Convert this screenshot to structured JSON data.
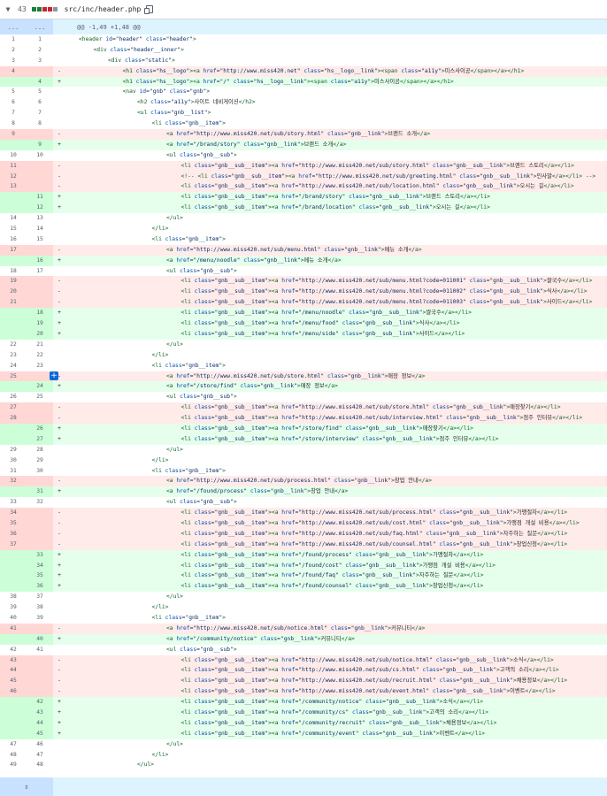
{
  "file": {
    "changes": "43",
    "path": "src/inc/header.php",
    "stat_colors": [
      "#1a7f37",
      "#1a7f37",
      "#cf222e",
      "#cf222e",
      "#8c959f"
    ]
  },
  "hunk": {
    "left": "...",
    "right": "...",
    "text": "@@ -1,49 +1,48 @@"
  },
  "rows": [
    {
      "type": "ctx",
      "l": "1",
      "r": "1",
      "code": "<header id=\"header\" class=\"header\">",
      "indent": 0
    },
    {
      "type": "ctx",
      "l": "2",
      "r": "2",
      "code": "<div class=\"header__inner\">",
      "indent": 1
    },
    {
      "type": "ctx",
      "l": "3",
      "r": "3",
      "code": "<div class=\"static\">",
      "indent": 2
    },
    {
      "type": "del",
      "l": "4",
      "r": "",
      "code": "<h1 class=\"hs__logo\"><a href=\"http://www.miss420.net\" class=\"hs__logo__link\"><span class=\"a11y\">미스사이공</span></a></h1>",
      "indent": 3
    },
    {
      "type": "add",
      "l": "",
      "r": "4",
      "code": "<h1 class=\"hs__logo\"><a href=\"/\" class=\"hs__logo__link\"><span class=\"a11y\">미스사이공</span></a></h1>",
      "indent": 3
    },
    {
      "type": "ctx",
      "l": "5",
      "r": "5",
      "code": "<nav id=\"gnb\" class=\"gnb\">",
      "indent": 3
    },
    {
      "type": "ctx",
      "l": "6",
      "r": "6",
      "code": "<h2 class=\"a11y\">사이트 네비게이션</h2>",
      "indent": 4
    },
    {
      "type": "ctx",
      "l": "7",
      "r": "7",
      "code": "<ul class=\"gnb__list\">",
      "indent": 4
    },
    {
      "type": "ctx",
      "l": "8",
      "r": "8",
      "code": "<li class=\"gnb__item\">",
      "indent": 5
    },
    {
      "type": "del",
      "l": "9",
      "r": "",
      "code": "<a href=\"http://www.miss420.net/sub/story.html\" class=\"gnb__link\">브랜드 소개</a>",
      "indent": 6
    },
    {
      "type": "add",
      "l": "",
      "r": "9",
      "code": "<a href=\"/brand/story\" class=\"gnb__link\">브랜드 소개</a>",
      "indent": 6
    },
    {
      "type": "ctx",
      "l": "10",
      "r": "10",
      "code": "<ul class=\"gnb__sub\">",
      "indent": 6
    },
    {
      "type": "del",
      "l": "11",
      "r": "",
      "code": "<li class=\"gnb__sub__item\"><a href=\"http://www.miss420.net/sub/story.html\" class=\"gnb__sub__link\">브랜드 스토리</a></li>",
      "indent": 7
    },
    {
      "type": "del",
      "l": "12",
      "r": "",
      "code": "<!-- <li class=\"gnb__sub__item\"><a href=\"http://www.miss420.net/sub/greeting.html\" class=\"gnb__sub__link\">인사말</a></li> -->",
      "indent": 7
    },
    {
      "type": "del",
      "l": "13",
      "r": "",
      "code": "<li class=\"gnb__sub__item\"><a href=\"http://www.miss420.net/sub/location.html\" class=\"gnb__sub__link\">오시는 길</a></li>",
      "indent": 7
    },
    {
      "type": "add",
      "l": "",
      "r": "11",
      "code": "<li class=\"gnb__sub__item\"><a href=\"/brand/story\" class=\"gnb__sub__link\">브랜드 스토리</a></li>",
      "indent": 7
    },
    {
      "type": "add",
      "l": "",
      "r": "12",
      "code": "<li class=\"gnb__sub__item\"><a href=\"/brand/location\" class=\"gnb__sub__link\">오시는 길</a></li>",
      "indent": 7
    },
    {
      "type": "ctx",
      "l": "14",
      "r": "13",
      "code": "</ul>",
      "indent": 6
    },
    {
      "type": "ctx",
      "l": "15",
      "r": "14",
      "code": "</li>",
      "indent": 5
    },
    {
      "type": "ctx",
      "l": "16",
      "r": "15",
      "code": "<li class=\"gnb__item\">",
      "indent": 5
    },
    {
      "type": "del",
      "l": "17",
      "r": "",
      "code": "<a href=\"http://www.miss420.net/sub/menu.html\" class=\"gnb__link\">메뉴 소개</a>",
      "indent": 6
    },
    {
      "type": "add",
      "l": "",
      "r": "16",
      "code": "<a href=\"/menu/noodle\" class=\"gnb__link\">메뉴 소개</a>",
      "indent": 6
    },
    {
      "type": "ctx",
      "l": "18",
      "r": "17",
      "code": "<ul class=\"gnb__sub\">",
      "indent": 6
    },
    {
      "type": "del",
      "l": "19",
      "r": "",
      "code": "<li class=\"gnb__sub__item\"><a href=\"http://www.miss420.net/sub/menu.html?code=011001\" class=\"gnb__sub__link\">쌀국수</a></li>",
      "indent": 7
    },
    {
      "type": "del",
      "l": "20",
      "r": "",
      "code": "<li class=\"gnb__sub__item\"><a href=\"http://www.miss420.net/sub/menu.html?code=011002\" class=\"gnb__sub__link\">식사</a></li>",
      "indent": 7
    },
    {
      "type": "del",
      "l": "21",
      "r": "",
      "code": "<li class=\"gnb__sub__item\"><a href=\"http://www.miss420.net/sub/menu.html?code=011003\" class=\"gnb__sub__link\">사이드</a></li>",
      "indent": 7
    },
    {
      "type": "add",
      "l": "",
      "r": "18",
      "code": "<li class=\"gnb__sub__item\"><a href=\"/menu/noodle\" class=\"gnb__sub__link\">쌀국수</a></li>",
      "indent": 7
    },
    {
      "type": "add",
      "l": "",
      "r": "19",
      "code": "<li class=\"gnb__sub__item\"><a href=\"/menu/food\" class=\"gnb__sub__link\">식사</a></li>",
      "indent": 7
    },
    {
      "type": "add",
      "l": "",
      "r": "20",
      "code": "<li class=\"gnb__sub__item\"><a href=\"/menu/side\" class=\"gnb__sub__link\">사이드</a></li>",
      "indent": 7
    },
    {
      "type": "ctx",
      "l": "22",
      "r": "21",
      "code": "</ul>",
      "indent": 6
    },
    {
      "type": "ctx",
      "l": "23",
      "r": "22",
      "code": "</li>",
      "indent": 5
    },
    {
      "type": "ctx",
      "l": "24",
      "r": "23",
      "code": "<li class=\"gnb__item\">",
      "indent": 5
    },
    {
      "type": "del",
      "l": "25",
      "r": "",
      "code": "<a href=\"http://www.miss420.net/sub/store.html\" class=\"gnb__link\">매장 정보</a>",
      "indent": 6,
      "plus": true
    },
    {
      "type": "add",
      "l": "",
      "r": "24",
      "code": "<a href=\"/store/find\" class=\"gnb__link\">매장 정보</a>",
      "indent": 6
    },
    {
      "type": "ctx",
      "l": "26",
      "r": "25",
      "code": "<ul class=\"gnb__sub\">",
      "indent": 6
    },
    {
      "type": "del",
      "l": "27",
      "r": "",
      "code": "<li class=\"gnb__sub__item\"><a href=\"http://www.miss420.net/sub/store.html\" class=\"gnb__sub__link\">매장찾기</a></li>",
      "indent": 7
    },
    {
      "type": "del",
      "l": "28",
      "r": "",
      "code": "<li class=\"gnb__sub__item\"><a href=\"http://www.miss420.net/sub/interview.html\" class=\"gnb__sub__link\">점주 인터뷰</a></li>",
      "indent": 7
    },
    {
      "type": "add",
      "l": "",
      "r": "26",
      "code": "<li class=\"gnb__sub__item\"><a href=\"/store/find\" class=\"gnb__sub__link\">매장찾기</a></li>",
      "indent": 7
    },
    {
      "type": "add",
      "l": "",
      "r": "27",
      "code": "<li class=\"gnb__sub__item\"><a href=\"/store/interview\" class=\"gnb__sub__link\">점주 인터뷰</a></li>",
      "indent": 7
    },
    {
      "type": "ctx",
      "l": "29",
      "r": "28",
      "code": "</ul>",
      "indent": 6
    },
    {
      "type": "ctx",
      "l": "30",
      "r": "29",
      "code": "</li>",
      "indent": 5
    },
    {
      "type": "ctx",
      "l": "31",
      "r": "30",
      "code": "<li class=\"gnb__item\">",
      "indent": 5
    },
    {
      "type": "del",
      "l": "32",
      "r": "",
      "code": "<a href=\"http://www.miss420.net/sub/process.html\" class=\"gnb__link\">창업 안내</a>",
      "indent": 6
    },
    {
      "type": "add",
      "l": "",
      "r": "31",
      "code": "<a href=\"/found/process\" class=\"gnb__link\">창업 안내</a>",
      "indent": 6
    },
    {
      "type": "ctx",
      "l": "33",
      "r": "32",
      "code": "<ul class=\"gnb__sub\">",
      "indent": 6
    },
    {
      "type": "del",
      "l": "34",
      "r": "",
      "code": "<li class=\"gnb__sub__item\"><a href=\"http://www.miss420.net/sub/process.html\" class=\"gnb__sub__link\">가맹절차</a></li>",
      "indent": 7
    },
    {
      "type": "del",
      "l": "35",
      "r": "",
      "code": "<li class=\"gnb__sub__item\"><a href=\"http://www.miss420.net/sub/cost.html\" class=\"gnb__sub__link\">가맹점 개설 비용</a></li>",
      "indent": 7
    },
    {
      "type": "del",
      "l": "36",
      "r": "",
      "code": "<li class=\"gnb__sub__item\"><a href=\"http://www.miss420.net/sub/faq.html\" class=\"gnb__sub__link\">자주하는 질문</a></li>",
      "indent": 7
    },
    {
      "type": "del",
      "l": "37",
      "r": "",
      "code": "<li class=\"gnb__sub__item\"><a href=\"http://www.miss420.net/sub/counsel.html\" class=\"gnb__sub__link\">창업신청</a></li>",
      "indent": 7
    },
    {
      "type": "add",
      "l": "",
      "r": "33",
      "code": "<li class=\"gnb__sub__item\"><a href=\"/found/process\" class=\"gnb__sub__link\">가맹절차</a></li>",
      "indent": 7
    },
    {
      "type": "add",
      "l": "",
      "r": "34",
      "code": "<li class=\"gnb__sub__item\"><a href=\"/found/cost\" class=\"gnb__sub__link\">가맹점 개설 비용</a></li>",
      "indent": 7
    },
    {
      "type": "add",
      "l": "",
      "r": "35",
      "code": "<li class=\"gnb__sub__item\"><a href=\"/found/faq\" class=\"gnb__sub__link\">자주하는 질문</a></li>",
      "indent": 7
    },
    {
      "type": "add",
      "l": "",
      "r": "36",
      "code": "<li class=\"gnb__sub__item\"><a href=\"/found/counsel\" class=\"gnb__sub__link\">창업신청</a></li>",
      "indent": 7
    },
    {
      "type": "ctx",
      "l": "38",
      "r": "37",
      "code": "</ul>",
      "indent": 6
    },
    {
      "type": "ctx",
      "l": "39",
      "r": "38",
      "code": "</li>",
      "indent": 5
    },
    {
      "type": "ctx",
      "l": "40",
      "r": "39",
      "code": "<li class=\"gnb__item\">",
      "indent": 5
    },
    {
      "type": "del",
      "l": "41",
      "r": "",
      "code": "<a href=\"http://www.miss420.net/sub/notice.html\" class=\"gnb__link\">커뮤니티</a>",
      "indent": 6
    },
    {
      "type": "add",
      "l": "",
      "r": "40",
      "code": "<a href=\"/community/notice\" class=\"gnb__link\">커뮤니티</a>",
      "indent": 6
    },
    {
      "type": "ctx",
      "l": "42",
      "r": "41",
      "code": "<ul class=\"gnb__sub\">",
      "indent": 6
    },
    {
      "type": "del",
      "l": "43",
      "r": "",
      "code": "<li class=\"gnb__sub__item\"><a href=\"http://www.miss420.net/sub/notice.html\" class=\"gnb__sub__link\">소식</a></li>",
      "indent": 7
    },
    {
      "type": "del",
      "l": "44",
      "r": "",
      "code": "<li class=\"gnb__sub__item\"><a href=\"http://www.miss420.net/sub/cs.html\" class=\"gnb__sub__link\">고객의 소리</a></li>",
      "indent": 7
    },
    {
      "type": "del",
      "l": "45",
      "r": "",
      "code": "<li class=\"gnb__sub__item\"><a href=\"http://www.miss420.net/sub/recruit.html\" class=\"gnb__sub__link\">채용정보</a></li>",
      "indent": 7
    },
    {
      "type": "del",
      "l": "46",
      "r": "",
      "code": "<li class=\"gnb__sub__item\"><a href=\"http://www.miss420.net/sub/event.html\" class=\"gnb__sub__link\">이벤트</a></li>",
      "indent": 7
    },
    {
      "type": "add",
      "l": "",
      "r": "42",
      "code": "<li class=\"gnb__sub__item\"><a href=\"/community/notice\" class=\"gnb__sub__link\">소식</a></li>",
      "indent": 7
    },
    {
      "type": "add",
      "l": "",
      "r": "43",
      "code": "<li class=\"gnb__sub__item\"><a href=\"/community/cs\" class=\"gnb__sub__link\">고객의 소리</a></li>",
      "indent": 7
    },
    {
      "type": "add",
      "l": "",
      "r": "44",
      "code": "<li class=\"gnb__sub__item\"><a href=\"/community/recruit\" class=\"gnb__sub__link\">채용정보</a></li>",
      "indent": 7
    },
    {
      "type": "add",
      "l": "",
      "r": "45",
      "code": "<li class=\"gnb__sub__item\"><a href=\"/community/event\" class=\"gnb__sub__link\">이벤트</a></li>",
      "indent": 7
    },
    {
      "type": "ctx",
      "l": "47",
      "r": "46",
      "code": "</ul>",
      "indent": 6
    },
    {
      "type": "ctx",
      "l": "48",
      "r": "47",
      "code": "</li>",
      "indent": 5
    },
    {
      "type": "ctx",
      "l": "49",
      "r": "48",
      "code": "</ul>",
      "indent": 4
    }
  ],
  "icons": {
    "collapse": "chevron-down-icon",
    "copy": "copy-icon",
    "expand": "expand-icon",
    "comment": "plus-icon"
  }
}
